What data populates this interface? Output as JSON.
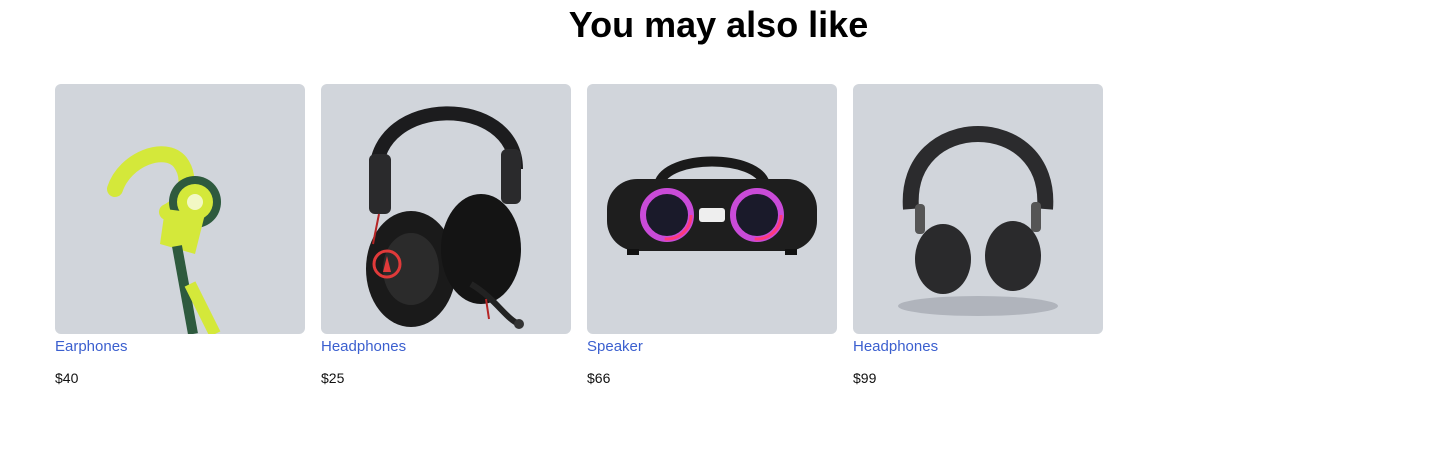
{
  "section": {
    "title": "You may also like"
  },
  "products": [
    {
      "name": "Earphones",
      "price": "$40",
      "image": "earphones-image"
    },
    {
      "name": "Headphones",
      "price": "$25",
      "image": "gaming-headset-image"
    },
    {
      "name": "Speaker",
      "price": "$66",
      "image": "speaker-image"
    },
    {
      "name": "Headphones",
      "price": "$99",
      "image": "headphones-image"
    }
  ],
  "colors": {
    "card_bg": "#d1d5db",
    "link": "#3b5fcf",
    "earphone_accent": "#d4e83a"
  }
}
